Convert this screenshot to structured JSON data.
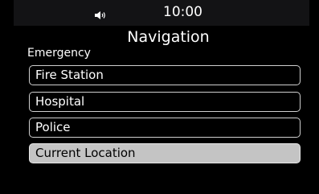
{
  "status_bar": {
    "time": "10:00",
    "volume_icon": "speaker-icon"
  },
  "screen": {
    "title": "Navigation",
    "section_label": "Emergency"
  },
  "menu": {
    "items": [
      {
        "label": "Fire Station",
        "selected": false
      },
      {
        "label": "Hospital",
        "selected": false
      },
      {
        "label": "Police",
        "selected": false
      },
      {
        "label": "Current Location",
        "selected": true
      }
    ]
  },
  "colors": {
    "background": "#000000",
    "status_bar": "#131315",
    "text": "#ffffff",
    "item_border": "#cfcfcf",
    "selected_background": "#c4c4c4",
    "selected_text": "#000000"
  }
}
